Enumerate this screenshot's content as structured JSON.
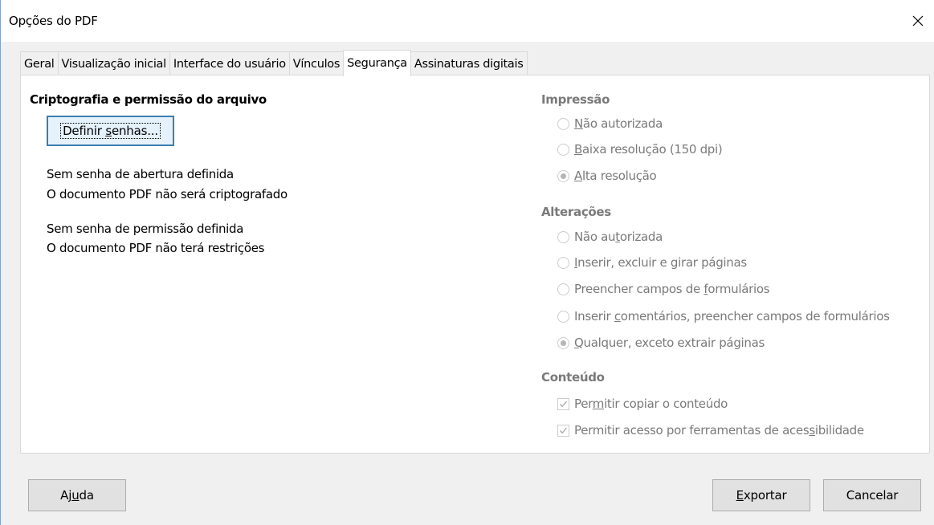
{
  "window": {
    "title": "Opções do PDF"
  },
  "tabs": [
    {
      "label": "Geral",
      "active": false
    },
    {
      "label": "Visualização inicial",
      "active": false
    },
    {
      "label": "Interface do usuário",
      "active": false
    },
    {
      "label": "Vínculos",
      "active": false
    },
    {
      "label": "Segurança",
      "active": true
    },
    {
      "label": "Assinaturas digitais",
      "active": false
    }
  ],
  "encryption": {
    "heading": "Criptografia e permissão do arquivo",
    "set_passwords_button": {
      "before": "Definir ",
      "mnemonic": "s",
      "after": "enhas..."
    },
    "open_password_status": "Sem senha de abertura definida",
    "open_password_detail": "O documento PDF não será criptografado",
    "permission_password_status": "Sem senha de permissão definida",
    "permission_password_detail": "O documento PDF não terá restrições"
  },
  "printing": {
    "heading": "Impressão",
    "options": [
      {
        "before": "",
        "mnemonic": "N",
        "after": "ão autorizada",
        "checked": false
      },
      {
        "before": "",
        "mnemonic": "B",
        "after": "aixa resolução (150 dpi)",
        "checked": false
      },
      {
        "before": "",
        "mnemonic": "A",
        "after": "lta resolução",
        "checked": true
      }
    ]
  },
  "changes": {
    "heading": "Alterações",
    "options": [
      {
        "before": "Não au",
        "mnemonic": "t",
        "after": "orizada",
        "checked": false
      },
      {
        "before": "",
        "mnemonic": "I",
        "after": "nserir, excluir e girar páginas",
        "checked": false
      },
      {
        "before": "Preencher campos de ",
        "mnemonic": "f",
        "after": "ormulários",
        "checked": false
      },
      {
        "before": "Inserir ",
        "mnemonic": "c",
        "after": "omentários, preencher campos de formulários",
        "checked": false
      },
      {
        "before": "",
        "mnemonic": "Q",
        "after": "ualquer, exceto extrair páginas",
        "checked": true
      }
    ]
  },
  "content": {
    "heading": "Conteúdo",
    "options": [
      {
        "before": "Per",
        "mnemonic": "m",
        "after": "itir copiar o conteúdo",
        "checked": true
      },
      {
        "before": "Permitir acesso por ferramentas de aces",
        "mnemonic": "s",
        "after": "ibilidade",
        "checked": true
      }
    ]
  },
  "footer": {
    "help_button": {
      "before": "Aj",
      "mnemonic": "u",
      "after": "da"
    },
    "export_button": {
      "before": "",
      "mnemonic": "E",
      "after": "xportar"
    },
    "cancel_button": {
      "label": "Cancelar"
    }
  },
  "colors": {
    "window_bg": "#f0f0f0",
    "panel_bg": "#ffffff",
    "disabled_text": "#7a7a7a",
    "default_button_border": "#3c7fb1",
    "window_border": "#7fa3d6"
  }
}
